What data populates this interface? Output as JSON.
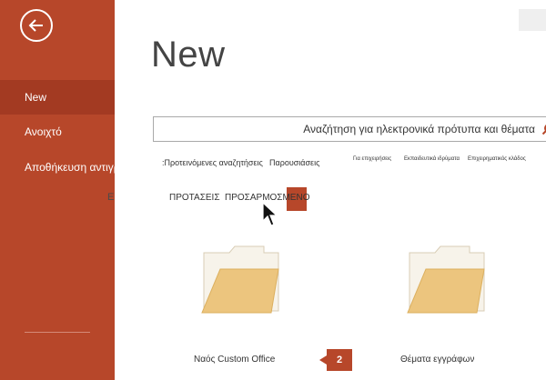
{
  "sidebar": {
    "items": [
      {
        "label": "New"
      },
      {
        "label": "Ανοιχτό"
      },
      {
        "label": "Αποθήκευση αντιγράφου"
      }
    ],
    "edge_letter": "E"
  },
  "main": {
    "title": "New",
    "search": {
      "placeholder": "Αναζήτηση για ηλεκτρονικά πρότυπα και θέματα"
    },
    "suggested": {
      "label": ":Προτεινόμενες αναζητήσεις",
      "links": [
        "Παρουσιάσεις",
        "Για επιχειρήσεις",
        "Εκπαιδευτικά ιδρύματα",
        "Επιχειρηματικός κλάδος"
      ]
    },
    "tabs": {
      "featured": "ΠΡΟΤΑΣΕΙΣ",
      "custom": "ΠΡΟΣΑΡΜΟΣΜΕΝΟ"
    },
    "folders": [
      {
        "label": "Ναός Custom Office"
      },
      {
        "label": "Θέματα εγγράφων"
      }
    ],
    "badge": "2"
  },
  "colors": {
    "accent": "#b7472a",
    "folder": "#ecc57e"
  }
}
